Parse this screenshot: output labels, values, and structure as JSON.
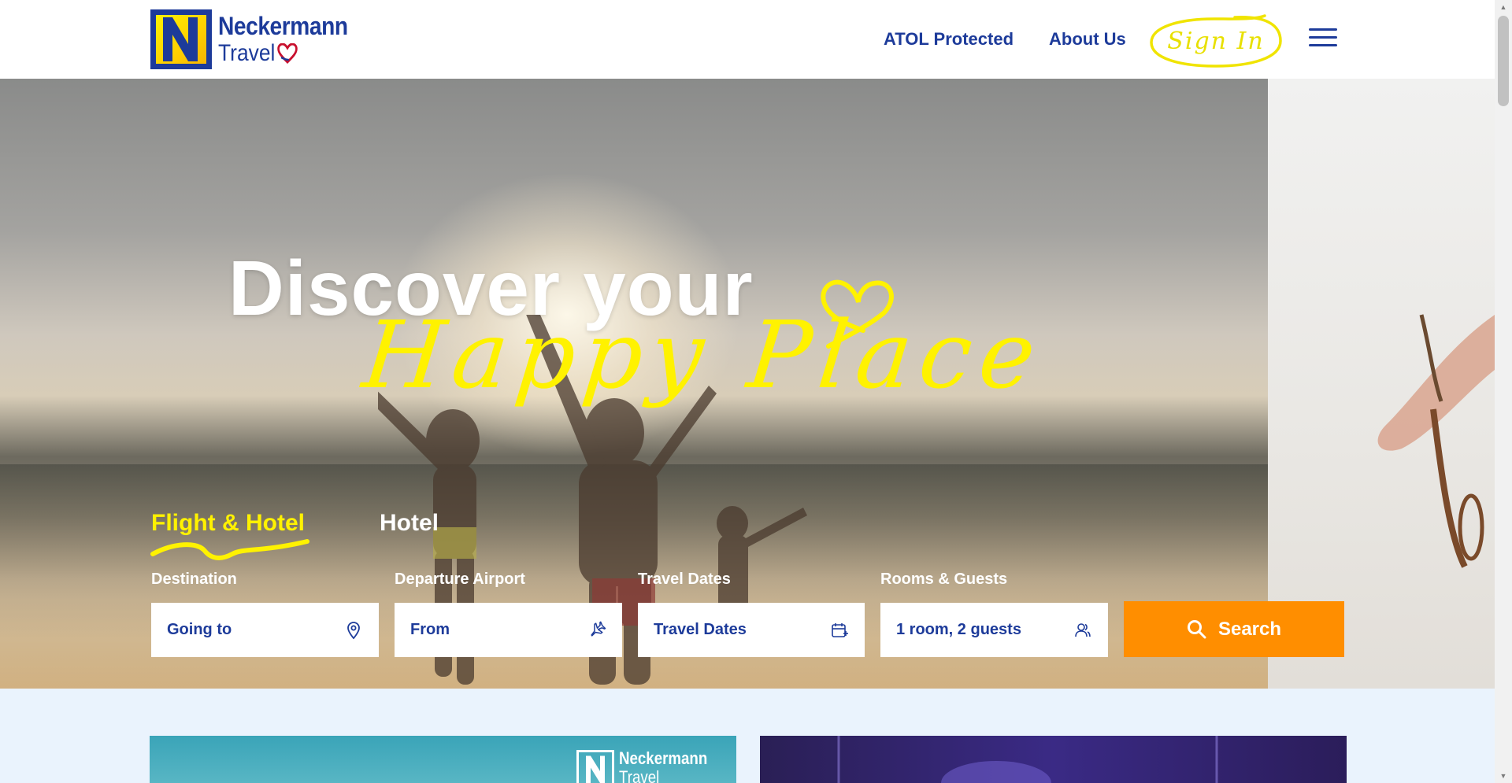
{
  "brand": {
    "name": "Neckermann",
    "sub": "Travel",
    "colors": {
      "primary": "#1d3b9a",
      "accent": "#fff200",
      "cta": "#ff8e00"
    }
  },
  "nav": {
    "atol": "ATOL Protected",
    "about": "About Us",
    "signin": "Sign In",
    "menu_icon": "hamburger-icon"
  },
  "hero": {
    "headline": "Discover your",
    "tagline": "Happy Place"
  },
  "tabs": [
    {
      "label": "Flight & Hotel",
      "active": true
    },
    {
      "label": "Hotel",
      "active": false
    }
  ],
  "search": {
    "fields": [
      {
        "label": "Destination",
        "value": "Going to",
        "icon": "location-pin-icon"
      },
      {
        "label": "Departure Airport",
        "value": "From",
        "icon": "airplane-icon"
      },
      {
        "label": "Travel Dates",
        "value": "Travel Dates",
        "icon": "calendar-icon"
      },
      {
        "label": "Rooms & Guests",
        "value": "1 room, 2 guests",
        "icon": "guests-icon"
      }
    ],
    "button": "Search",
    "button_icon": "search-icon"
  },
  "promo": {
    "left_logo_name": "Neckermann",
    "left_logo_sub": "Travel"
  }
}
